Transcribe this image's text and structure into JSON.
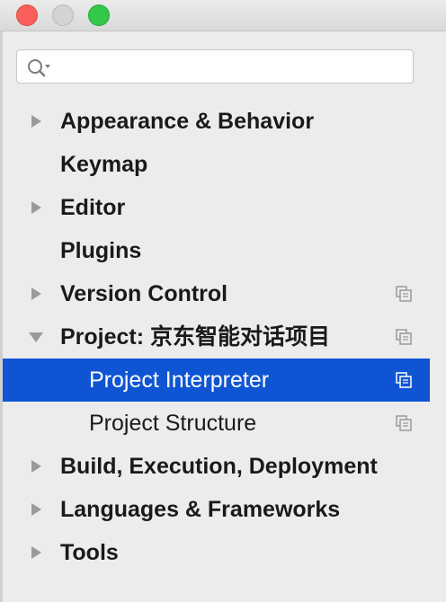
{
  "search": {
    "placeholder": "",
    "value": ""
  },
  "tree": {
    "items": [
      {
        "label": "Appearance & Behavior",
        "arrow": "collapsed",
        "level": 0,
        "bold": true,
        "copy_icon": false
      },
      {
        "label": "Keymap",
        "arrow": "none",
        "level": 0,
        "bold": true,
        "copy_icon": false
      },
      {
        "label": "Editor",
        "arrow": "collapsed",
        "level": 0,
        "bold": true,
        "copy_icon": false
      },
      {
        "label": "Plugins",
        "arrow": "none",
        "level": 0,
        "bold": true,
        "copy_icon": false
      },
      {
        "label": "Version Control",
        "arrow": "collapsed",
        "level": 0,
        "bold": true,
        "copy_icon": true
      },
      {
        "label": "Project: 京东智能对话项目",
        "arrow": "expanded",
        "level": 0,
        "bold": true,
        "copy_icon": true
      },
      {
        "label": "Project Interpreter",
        "arrow": "none",
        "level": 1,
        "bold": false,
        "copy_icon": true,
        "selected": true
      },
      {
        "label": "Project Structure",
        "arrow": "none",
        "level": 1,
        "bold": false,
        "copy_icon": true
      },
      {
        "label": "Build, Execution, Deployment",
        "arrow": "collapsed",
        "level": 0,
        "bold": true,
        "copy_icon": false
      },
      {
        "label": "Languages & Frameworks",
        "arrow": "collapsed",
        "level": 0,
        "bold": true,
        "copy_icon": false
      },
      {
        "label": "Tools",
        "arrow": "collapsed",
        "level": 0,
        "bold": true,
        "copy_icon": false
      }
    ]
  },
  "colors": {
    "selection": "#0f55d3",
    "close": "#fc605c",
    "zoom": "#34c84a",
    "minimize_inactive": "#d3d3d3"
  },
  "icons": {
    "search": "search-icon",
    "copy": "copy-settings-icon",
    "close": "close-window-icon",
    "minimize": "minimize-window-icon",
    "zoom": "zoom-window-icon"
  }
}
